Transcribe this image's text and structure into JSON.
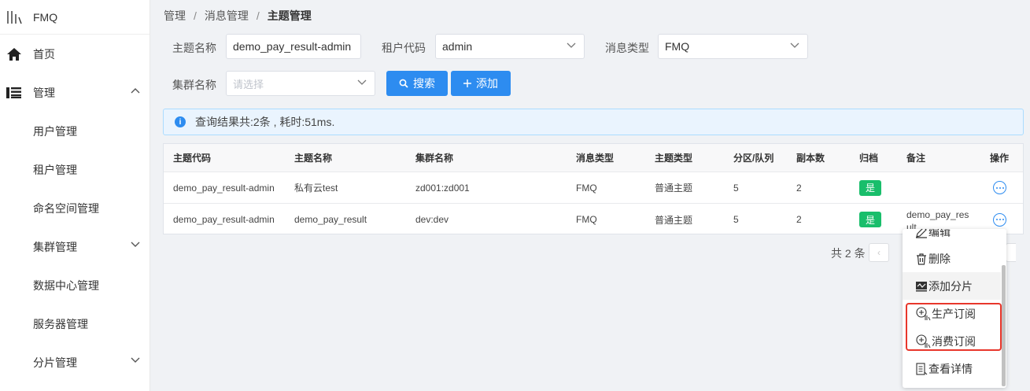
{
  "app": {
    "title": "FMQ"
  },
  "sidebar": {
    "home": "首页",
    "manage": "管理",
    "items": [
      "用户管理",
      "租户管理",
      "命名空间管理",
      "集群管理",
      "数据中心管理",
      "服务器管理",
      "分片管理"
    ]
  },
  "breadcrumb": {
    "l1": "管理",
    "l2": "消息管理",
    "l3": "主题管理",
    "sep": "/"
  },
  "filters": {
    "topic_name_label": "主题名称",
    "topic_name_value": "demo_pay_result-admin",
    "tenant_label": "租户代码",
    "tenant_value": "admin",
    "msg_type_label": "消息类型",
    "msg_type_value": "FMQ",
    "cluster_label": "集群名称",
    "cluster_placeholder": "请选择",
    "search_btn": "搜索",
    "add_btn": "添加"
  },
  "alert": {
    "text": "查询结果共:2条 , 耗时:51ms."
  },
  "table": {
    "headers": [
      "主题代码",
      "主题名称",
      "集群名称",
      "消息类型",
      "主题类型",
      "分区/队列",
      "副本数",
      "归档",
      "备注",
      "操作"
    ],
    "rows": [
      [
        "demo_pay_result-admin",
        "私有云test",
        "zd001:zd001",
        "FMQ",
        "普通主题",
        "5",
        "2",
        "是",
        ""
      ],
      [
        "demo_pay_result-admin",
        "demo_pay_result",
        "dev:dev",
        "FMQ",
        "普通主题",
        "5",
        "2",
        "是",
        "demo_pay_result"
      ]
    ]
  },
  "pager": {
    "total": "共 2 条",
    "prev": "‹"
  },
  "menu": {
    "items": [
      "编辑",
      "删除",
      "添加分片",
      "生产订阅",
      "消费订阅",
      "查看详情"
    ],
    "icons": [
      "edit-icon",
      "trash-icon",
      "shard-icon",
      "add-subscribe-icon",
      "add-subscribe-icon",
      "document-icon"
    ]
  },
  "colors": {
    "primary": "#2d8cf0",
    "success": "#19be6b",
    "highlight": "#e8372c"
  }
}
